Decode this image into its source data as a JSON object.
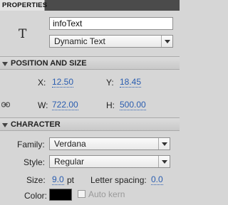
{
  "tab": {
    "label": "PROPERTIES"
  },
  "instance": {
    "symbol": "T",
    "name_value": "infoText",
    "text_type": "Dynamic Text"
  },
  "position_size": {
    "title": "POSITION AND SIZE",
    "x_label": "X:",
    "x_value": "12.50",
    "y_label": "Y:",
    "y_value": "18.45",
    "w_label": "W:",
    "w_value": "722.00",
    "h_label": "H:",
    "h_value": "500.00"
  },
  "character": {
    "title": "CHARACTER",
    "family_label": "Family:",
    "family_value": "Verdana",
    "style_label": "Style:",
    "style_value": "Regular",
    "size_label": "Size:",
    "size_value": "9.0",
    "size_unit": "pt",
    "spacing_label": "Letter spacing:",
    "spacing_value": "0.0",
    "color_label": "Color:",
    "color_value": "#000000",
    "autokern_label": "Auto kern"
  },
  "colors": {
    "link": "#2a5db0",
    "panel": "#d6d6d6",
    "tabbar": "#4b4b4b"
  }
}
